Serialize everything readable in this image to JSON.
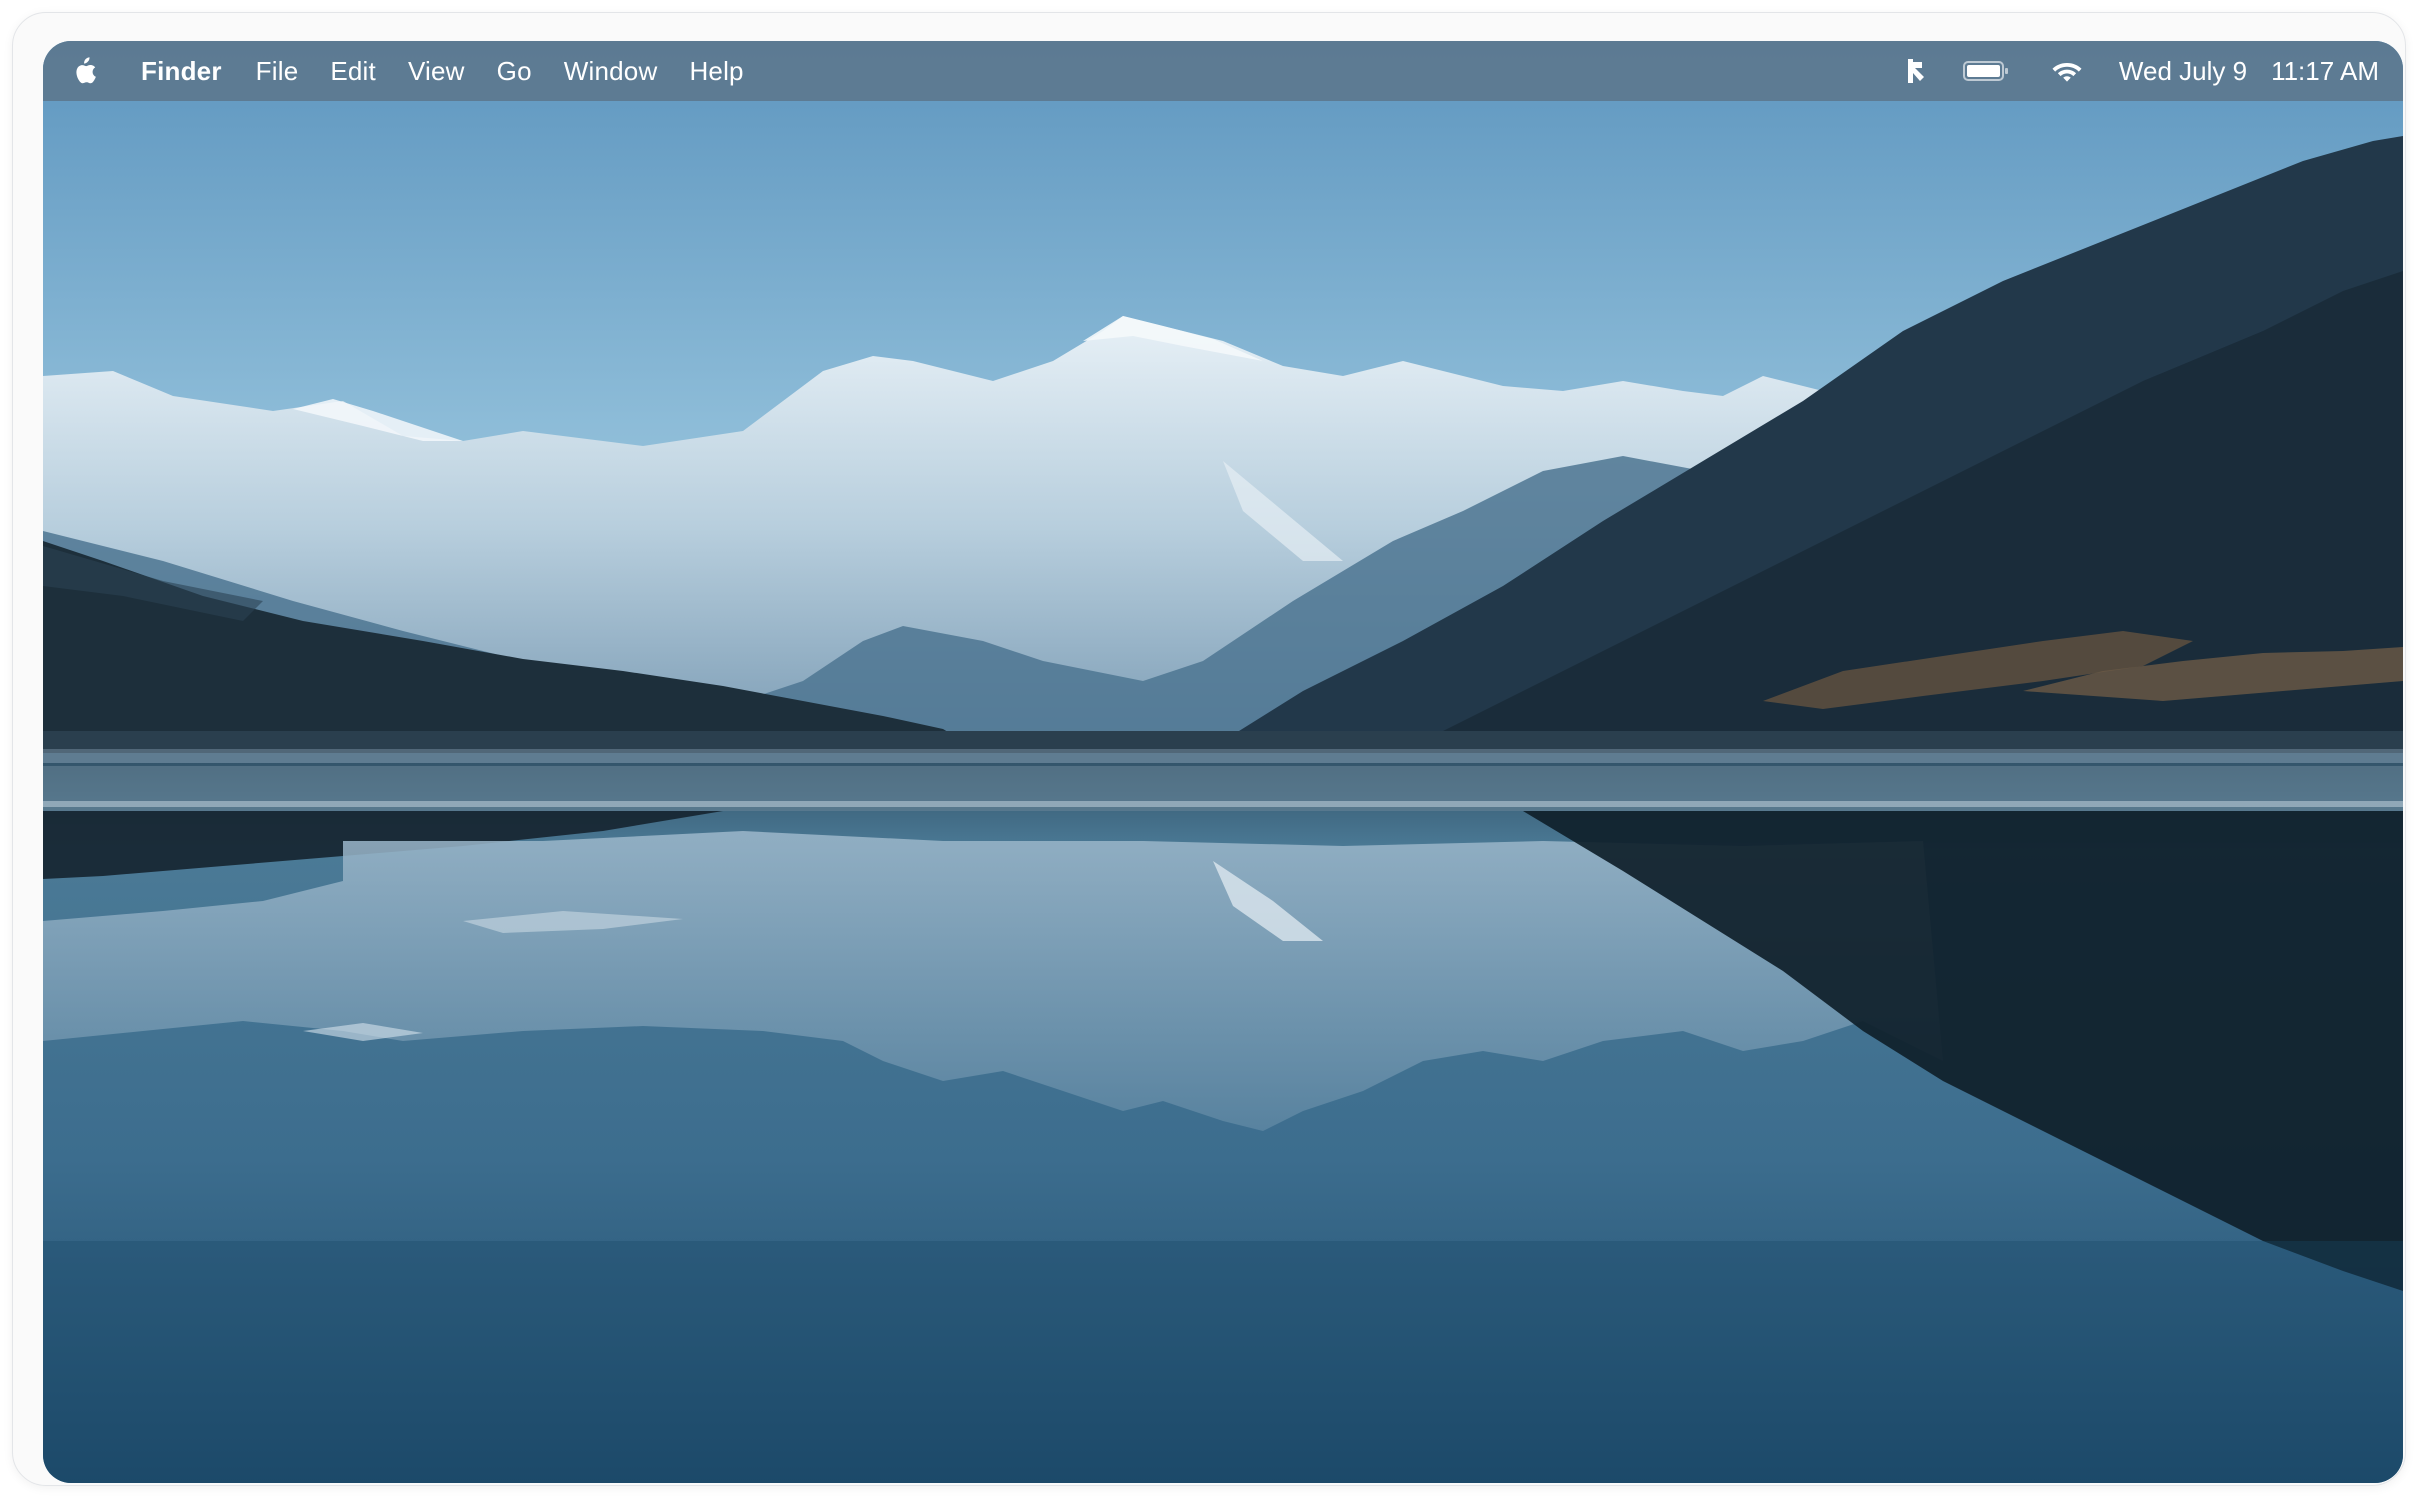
{
  "menubar": {
    "apple_icon": "apple-logo-icon",
    "app_name": "Finder",
    "menus": [
      "File",
      "Edit",
      "View",
      "Go",
      "Window",
      "Help"
    ],
    "status_icons": [
      "app-tray-icon",
      "battery-icon",
      "wifi-icon"
    ],
    "date": "Wed July 9",
    "time": "11:17 AM"
  },
  "desktop": {
    "wallpaper": "mountain-lake-reflection",
    "colors": {
      "sky_top": "#5f97c0",
      "sky_horizon": "#a9cde0",
      "water_deep": "#1f4e6e",
      "menubar": "#5c768c"
    }
  }
}
